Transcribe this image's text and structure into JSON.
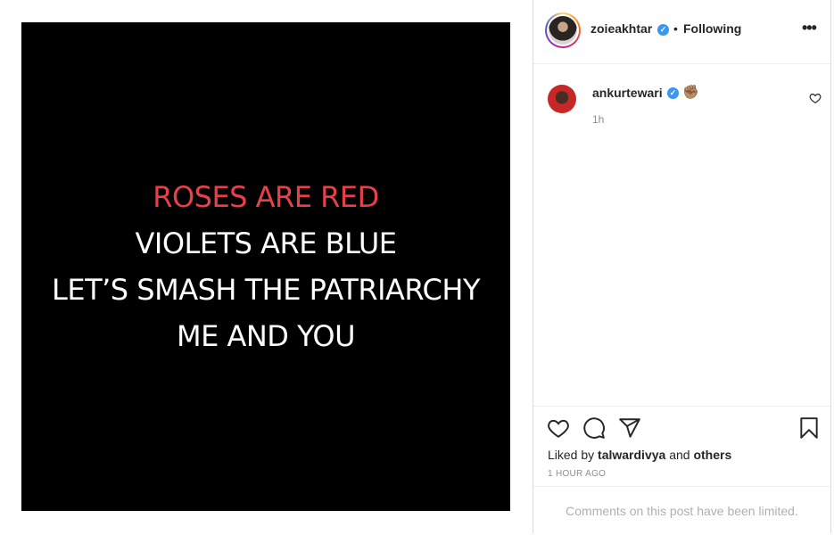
{
  "post": {
    "lines": [
      {
        "text": "ROSES ARE RED",
        "color": "#e8404a"
      },
      {
        "text": "VIOLETS ARE BLUE",
        "color": "#ffffff"
      },
      {
        "text": "LET’S SMASH THE PATRIARCHY",
        "color": "#ffffff"
      },
      {
        "text": "ME AND YOU",
        "color": "#ffffff"
      }
    ],
    "background_color": "#000000"
  },
  "header": {
    "username": "zoieakhtar",
    "verified_mark": "✓",
    "separator": "•",
    "follow_status": "Following",
    "more_label": "•••",
    "avatar_icon": "profile-photo"
  },
  "comment": {
    "username": "ankurtewari",
    "verified_mark": "✓",
    "text": "✊🏽",
    "time": "1h",
    "like_icon": "heart-outline-icon"
  },
  "actions": {
    "icons": [
      "heart-outline-icon",
      "comment-icon",
      "share-icon",
      "bookmark-icon"
    ],
    "liked_by_prefix": "Liked by",
    "liked_by_user": "talwardivya",
    "liked_by_middle": "and",
    "liked_by_others": "others",
    "time_ago": "1 HOUR AGO"
  },
  "footer": {
    "comments_notice": "Comments on this post have been limited."
  },
  "colors": {
    "verified_blue": "#3897f0",
    "text_primary": "#262626",
    "text_secondary": "#8e8e8e"
  }
}
